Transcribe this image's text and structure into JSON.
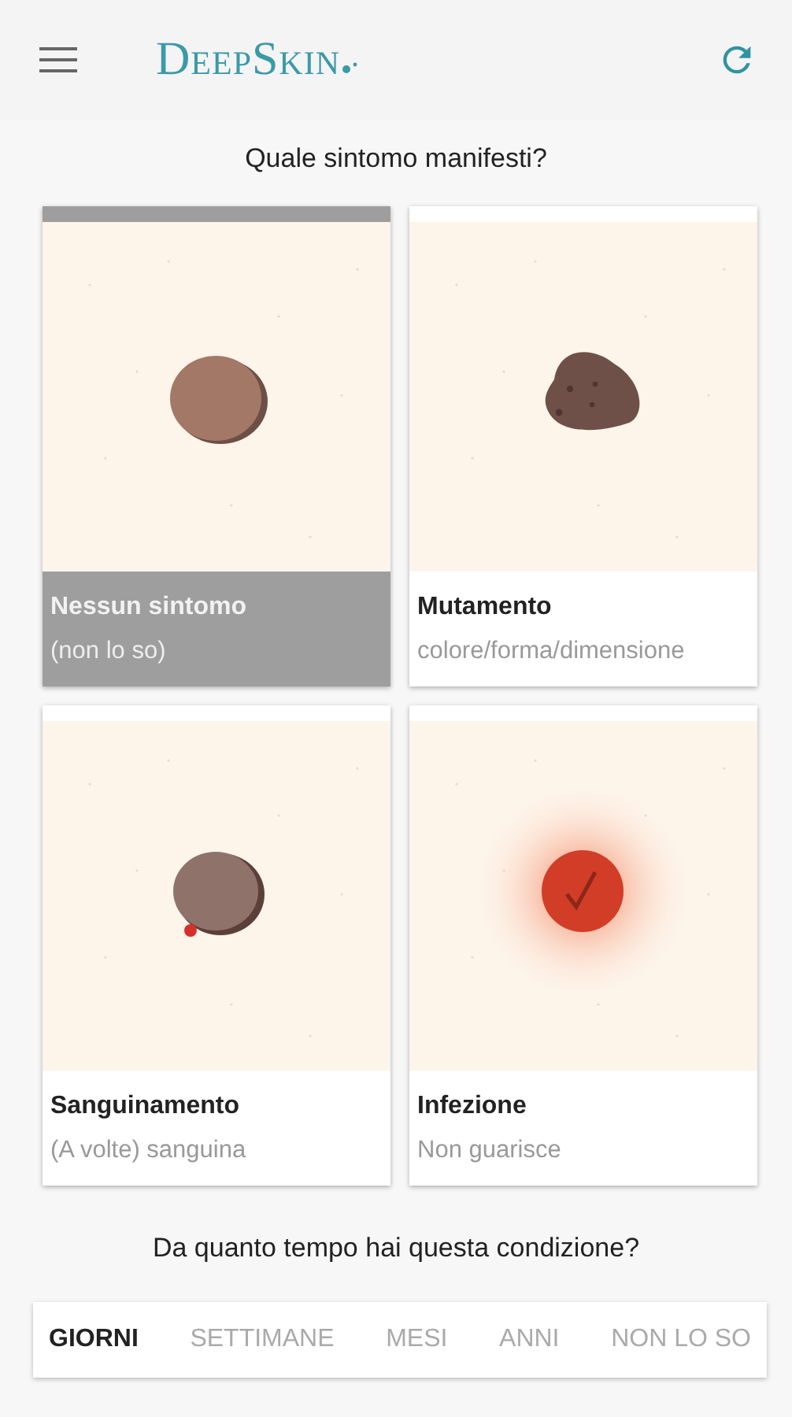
{
  "app_bar": {
    "logo": "DeepSkin"
  },
  "symptom_question": "Quale sintomo manifesti?",
  "symptoms": [
    {
      "kind": "round",
      "title": "Nessun sintomo",
      "subtitle": "(non lo so)",
      "selected": true
    },
    {
      "kind": "irregular",
      "title": "Mutamento",
      "subtitle": "colore/forma/dimensione",
      "selected": false
    },
    {
      "kind": "bleeding",
      "title": "Sanguinamento",
      "subtitle": "(A volte) sanguina",
      "selected": false
    },
    {
      "kind": "infected",
      "title": "Infezione",
      "subtitle": "Non guarisce",
      "selected": false
    }
  ],
  "duration_question": "Da quanto tempo hai questa condizione?",
  "duration_tabs": [
    {
      "label": "GIORNI",
      "selected": true
    },
    {
      "label": "SETTIMANE",
      "selected": false
    },
    {
      "label": "MESI",
      "selected": false
    },
    {
      "label": "ANNI",
      "selected": false
    },
    {
      "label": "NON LO SO",
      "selected": false
    }
  ]
}
